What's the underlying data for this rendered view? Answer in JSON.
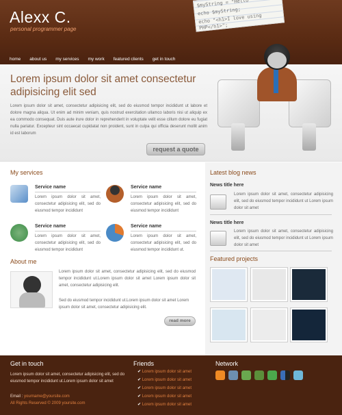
{
  "header": {
    "logo": "Alexx C.",
    "tagline": "personal programmer page",
    "note_lines": [
      "$myString = \"Hello\"",
      "echo $myString;",
      "echo \"<h1>I love using PHP</h1>\";"
    ]
  },
  "nav": {
    "items": [
      {
        "label": "home"
      },
      {
        "label": "about us"
      },
      {
        "label": "my services"
      },
      {
        "label": "my work"
      },
      {
        "label": "featured clients"
      },
      {
        "label": "get in touch"
      }
    ]
  },
  "hero": {
    "title": "Lorem ipsum dolor sit amet consectetur adipisicing elit sed",
    "text": "Lorem ipsum dolor sit amet, consectetur adipisicing elit, sed do eiusmod tempor incididunt ut labore et dolore magna aliqua. Ut enim ad minim veniam, quis nostrud exercitation ullamco laboris nisi ut aliquip ex ea commodo consequat. Duis aute irure dolor in reprehenderit in voluptate velit esse cillum dolore eu fugiat nulla pariatur. Excepteur sint occaecat cupidatat non proident, sunt in culpa qui officia deserunt mollit anim id est laborum",
    "button": "request a quote"
  },
  "services": {
    "title": "My services",
    "items": [
      {
        "title": "Service name",
        "text": "Lorem ipsum dolor sit amet, consectetur adipisicing elit, sed do eiusmod tempor incididunt",
        "color": "#5b8fc9"
      },
      {
        "title": "Service name",
        "text": "Lorem ipsum dolor sit amet, consectetur adipisicing elit, sed do eiusmod tempor incididunt",
        "color": "#b45f2b"
      },
      {
        "title": "Service name",
        "text": "Lorem ipsum dolor sit amet, consectetur adipisicing elit, sed do eiusmod tempor incididunt",
        "color": "#3f8f4a"
      },
      {
        "title": "Service name",
        "text": "Lorem ipsum dolor sit amet, consectetur adipisicing elit, sed do eiusmod tempor incididunt ut.",
        "color": "#e07a30"
      }
    ]
  },
  "about": {
    "title": "About me",
    "text": "Lorem ipsum dolor sit amet, consectetur adipisicing elit, sed do eiusmod tempor incididunt ut.Lorem ipsum dolor sit amet Lorem ipsum dolor sit amet, consectetur adipisicing elit.",
    "text2": "Sed do eiusmod tempor incididunt ut.Lorem ipsum dolor sit amet Lorem ipsum dolor sit amet, consectetur adipisicing elit.",
    "button": "read more"
  },
  "blog": {
    "title": "Latest blog news",
    "items": [
      {
        "title": "News title here",
        "text": "Lorem ipsum dolor sit amet, consectetur adipisicing elit, sed do eiusmod tempor incididunt ut Lorem ipsum dolor sit amet"
      },
      {
        "title": "News title here",
        "text": "Lorem ipsum dolor sit amet, consectetur adipisicing elit, sed do eiusmod tempor incididunt ut Lorem ipsum dolor sit amet"
      }
    ]
  },
  "projects": {
    "title": "Featured projects",
    "thumbs": [
      {
        "color": "#dfe8f2"
      },
      {
        "color": "#e8e8e8"
      },
      {
        "color": "#1a2a3a"
      },
      {
        "color": "#d8e6f0"
      },
      {
        "color": "#ececec"
      },
      {
        "color": "#14263a"
      }
    ]
  },
  "footer": {
    "contact_title": "Get in touch",
    "contact_text": "Lorem ipsum dolor sit amet, consectetur adipisicing elit, sed do eiusmod tempor incididunt ut.Lorem ipsum dolor sit amet",
    "email_label": "Email :",
    "email": "yourname@yoursite.com",
    "copyright": "All Rights Reserved © 2009 yoursite.com",
    "friends_title": "Friends",
    "friends": [
      "Lorem ipsum dolor sit amet",
      "Lorem ipsum dolor sit amet",
      "Lorem ipsum dolor sit amet",
      "Lorem ipsum dolor sit amet",
      "Lorem ipsum dolor sit amet"
    ],
    "network_title": "Network",
    "network_icons": [
      {
        "name": "rss-icon",
        "color": "#f08a24"
      },
      {
        "name": "digg-icon",
        "color": "#6d8fb0"
      },
      {
        "name": "delicious-icon",
        "color": "#6aa84f"
      },
      {
        "name": "stumbleupon-icon",
        "color": "#5b8f3a"
      },
      {
        "name": "technorati-icon",
        "color": "#4ca84c"
      },
      {
        "name": "delicious-blocks-icon",
        "color": "#3a6db8"
      },
      {
        "name": "twitter-icon",
        "color": "#6fb7d8"
      }
    ]
  }
}
